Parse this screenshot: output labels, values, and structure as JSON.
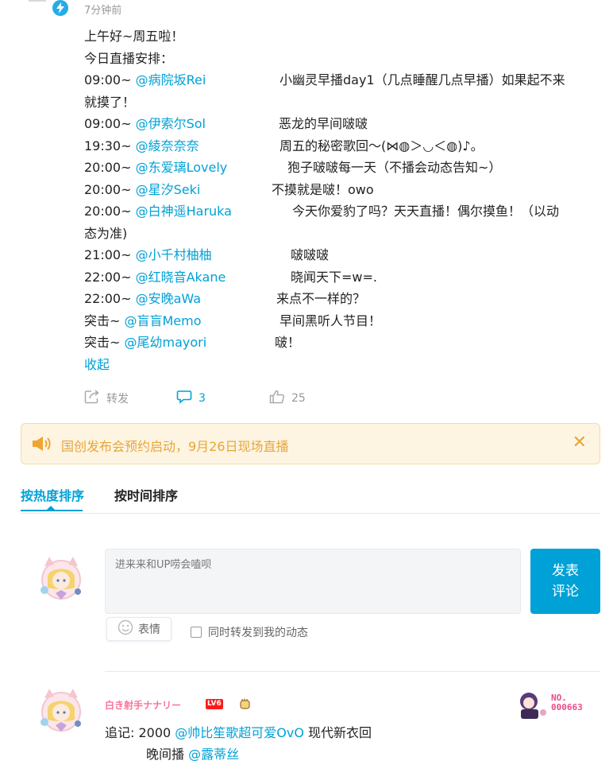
{
  "post": {
    "time": "7分钟前",
    "greeting": "上午好~周五啦！",
    "schedule_title": "今日直播安排：",
    "schedule": [
      {
        "time": "09:00~",
        "user": "@病院坂Rei",
        "desc": "小幽灵早播day1（几点睡醒几点早播）如果起不来",
        "desc_cont": "就摸了！"
      },
      {
        "time": "09:00~",
        "user": "@伊索尔Sol",
        "desc": "恶龙的早间啵啵"
      },
      {
        "time": "19:30~",
        "user": "@綾奈奈奈",
        "desc": "周五的秘密歌回～(⋈◍＞◡＜◍)♪。"
      },
      {
        "time": "20:00~",
        "user": "@东爱璃Lovely",
        "desc": "狍子啵啵每一天（不播会动态告知~）"
      },
      {
        "time": "20:00~",
        "user": "@星汐Seki",
        "desc": "不摸就是啵！owo"
      },
      {
        "time": "20:00~",
        "user": "@白神遥Haruka",
        "desc": "今天你爱豹了吗？天天直播！偶尔摸鱼！（以动",
        "desc_cont": "态为准)"
      },
      {
        "time": "21:00~",
        "user": "@小千村柚柚",
        "desc": "啵啵啵"
      },
      {
        "time": "22:00~",
        "user": "@红晓音Akane",
        "desc": "晓闻天下=w=."
      },
      {
        "time": "22:00~",
        "user": "@安晚aWa",
        "desc": "来点不一样的？"
      },
      {
        "time": "突击~ ",
        "user": "@盲盲Memo",
        "desc": "早间黑听人节目！"
      },
      {
        "time": "突击~ ",
        "user": "@尾幼mayori",
        "desc": "啵！"
      }
    ],
    "collapse_label": "收起"
  },
  "actions": {
    "forward_label": "转发",
    "comment_count": "3",
    "like_count": "25"
  },
  "notice": {
    "text": "国创发布会预约启动，9月26日现场直播",
    "close_symbol": "✕"
  },
  "tabs": [
    {
      "label": "按热度排序"
    },
    {
      "label": "按时间排序"
    }
  ],
  "comment_form": {
    "placeholder": "进来来和UP唠会嗑呗",
    "submit_label_1": "发表",
    "submit_label_2": "评论",
    "emoji_label": "表情",
    "forward_checkbox_label": "同时转发到我的动态"
  },
  "first_comment": {
    "username": "白き射手ナナリー",
    "level": "LV6",
    "line1_prefix": "追记: 2000 ",
    "line1_mention": "@帅比笙歌超可爱OvO",
    "line1_suffix": "  现代新衣回",
    "line2_prefix": "晚间播 ",
    "line2_mention": "@露蒂丝",
    "fan_badge_no_label": "NO.",
    "fan_badge_number": "000663"
  },
  "colors": {
    "link": "#00a1d6",
    "accent": "#00a1d6",
    "username_pink": "#fb7299",
    "notice_bg": "#fdf5e2",
    "notice_text": "#e8a53a"
  }
}
